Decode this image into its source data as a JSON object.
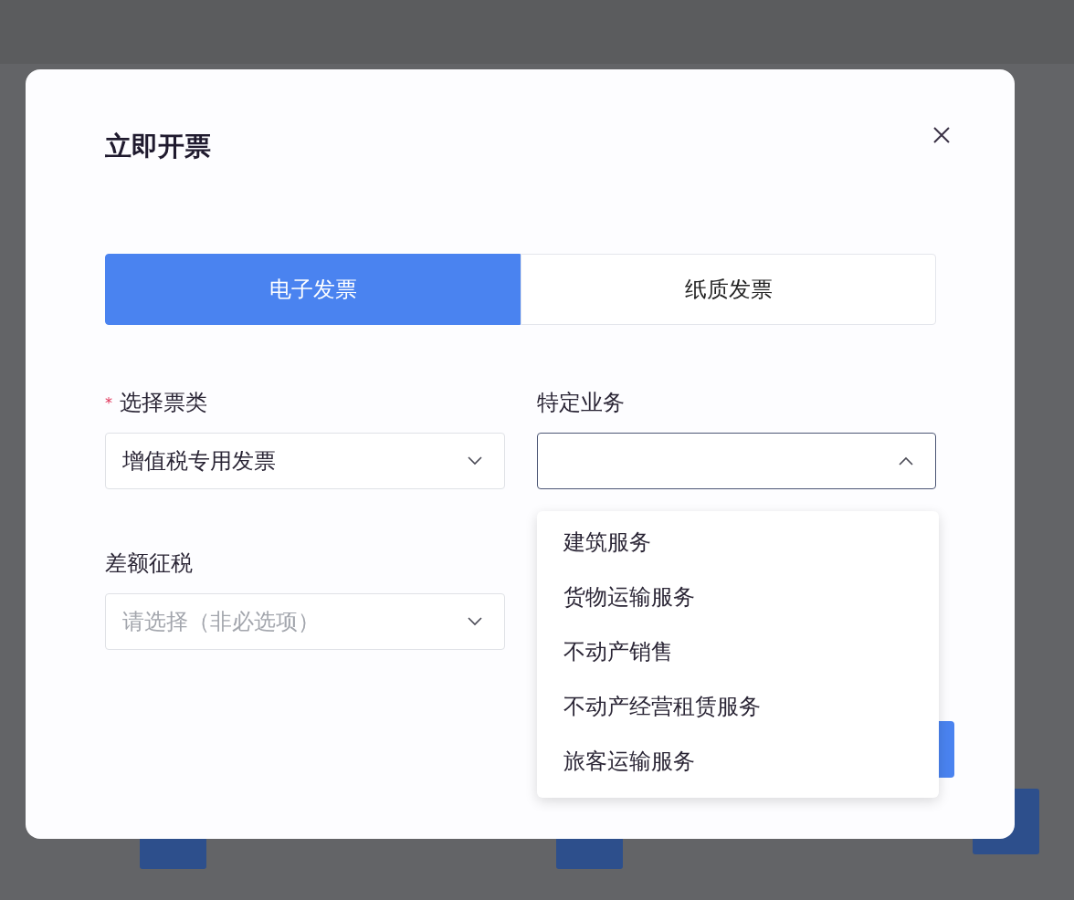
{
  "dialog": {
    "title": "立即开票",
    "tabs": [
      {
        "label": "电子发票",
        "selected": true
      },
      {
        "label": "纸质发票",
        "selected": false
      }
    ],
    "fields": [
      {
        "required_mark": "*",
        "label": "选择票类",
        "value": "增值税专用发票",
        "open": false
      },
      {
        "label": "特定业务",
        "open": true
      },
      {
        "label": "差额征税",
        "placeholder": "请选择（非必选项）",
        "open": false
      }
    ],
    "dropdown": {
      "options": [
        "建筑服务",
        "货物运输服务",
        "不动产销售",
        "不动产经营租赁服务",
        "旅客运输服务"
      ]
    }
  }
}
